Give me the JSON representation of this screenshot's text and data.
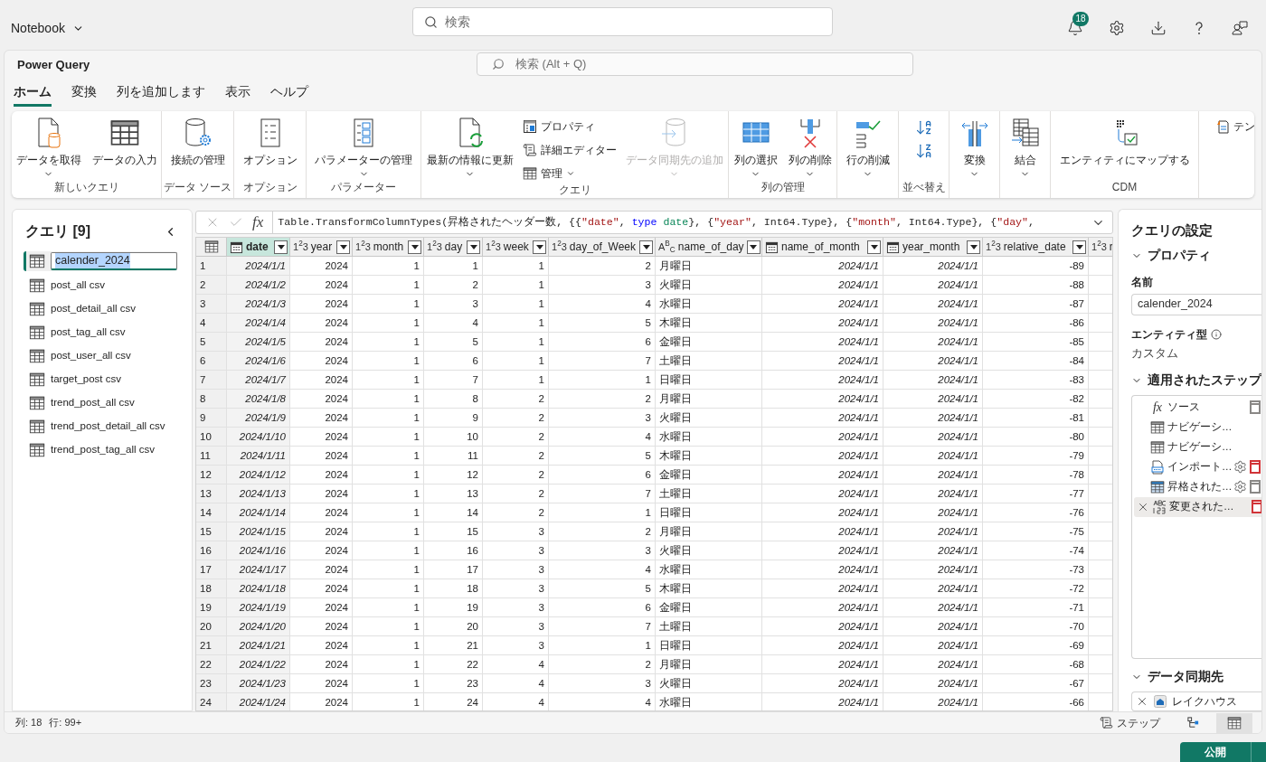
{
  "app_bar": {
    "title": "Notebook",
    "search": {
      "placeholder": "検索"
    },
    "notifications": {
      "count": "18"
    }
  },
  "window": {
    "title": "Power Query",
    "search": {
      "placeholder": "検索 (Alt + Q)"
    }
  },
  "tabs": [
    {
      "label": "ホーム",
      "selected": true
    },
    {
      "label": "変換",
      "selected": false
    },
    {
      "label": "列を追加します",
      "selected": false
    },
    {
      "label": "表示",
      "selected": false
    },
    {
      "label": "ヘルプ",
      "selected": false
    }
  ],
  "ribbon": [
    {
      "label": "新しいクエリ",
      "items": [
        {
          "kind": "large",
          "label": "データを取得",
          "dropdown": true,
          "disabled": false
        },
        {
          "kind": "large",
          "label": "データの入力",
          "dropdown": false,
          "disabled": false
        }
      ]
    },
    {
      "label": "データ ソース",
      "items": [
        {
          "kind": "large",
          "label": "接続の管理",
          "dropdown": false,
          "disabled": false
        }
      ]
    },
    {
      "label": "オプション",
      "items": [
        {
          "kind": "large",
          "label": "オプション",
          "dropdown": false,
          "disabled": false
        }
      ]
    },
    {
      "label": "パラメーター",
      "items": [
        {
          "kind": "large",
          "label": "パラメーターの管理",
          "dropdown": true,
          "disabled": false
        }
      ]
    },
    {
      "label": "クエリ",
      "items": [
        {
          "kind": "large",
          "label": "最新の情報に更新",
          "dropdown": true,
          "disabled": false
        },
        {
          "kind": "small_stack",
          "buttons": [
            {
              "label": "プロパティ",
              "dropdown": false
            },
            {
              "label": "詳細エディター",
              "dropdown": false
            },
            {
              "label": "管理",
              "dropdown": true
            }
          ]
        },
        {
          "kind": "large",
          "label": "データ同期先の追加",
          "dropdown": true,
          "disabled": true
        }
      ]
    },
    {
      "label": "列の管理",
      "items": [
        {
          "kind": "large",
          "label": "列の選択",
          "dropdown": true,
          "disabled": false
        },
        {
          "kind": "large",
          "label": "列の削除",
          "dropdown": true,
          "disabled": false
        }
      ]
    },
    {
      "items": [
        {
          "kind": "large",
          "label": "行の削減",
          "dropdown": true,
          "disabled": false
        }
      ]
    },
    {
      "label": "並べ替え",
      "items": [
        {
          "kind": "sort_stack"
        }
      ]
    },
    {
      "items": [
        {
          "kind": "large",
          "label": "変換",
          "dropdown": true,
          "disabled": false
        }
      ]
    },
    {
      "items": [
        {
          "kind": "large",
          "label": "結合",
          "dropdown": true,
          "disabled": false
        }
      ]
    },
    {
      "label": "CDM",
      "items": [
        {
          "kind": "large",
          "label": "エンティティにマップする",
          "dropdown": false,
          "disabled": false
        }
      ]
    },
    {
      "items": [
        {
          "kind": "small_stack",
          "buttons": [
            {
              "label": "テン",
              "dropdown": false
            }
          ]
        }
      ]
    }
  ],
  "queries": {
    "title": "クエリ [9]",
    "items": [
      {
        "name": "calender_2024",
        "selected": true
      },
      {
        "name": "post_all csv",
        "selected": false
      },
      {
        "name": "post_detail_all csv",
        "selected": false
      },
      {
        "name": "post_tag_all csv",
        "selected": false
      },
      {
        "name": "post_user_all csv",
        "selected": false
      },
      {
        "name": "target_post csv",
        "selected": false
      },
      {
        "name": "trend_post_all csv",
        "selected": false
      },
      {
        "name": "trend_post_detail_all csv",
        "selected": false
      },
      {
        "name": "trend_post_tag_all csv",
        "selected": false
      }
    ]
  },
  "formula_bar": {
    "fx_glyph": "fx",
    "tokens": [
      {
        "kind": "plain",
        "text": "Table.TransformColumnTypes(昇格されたヘッダー数, {{"
      },
      {
        "kind": "string",
        "text": "\"date\""
      },
      {
        "kind": "plain",
        "text": ", "
      },
      {
        "kind": "keyword",
        "text": "type "
      },
      {
        "kind": "type",
        "text": "date"
      },
      {
        "kind": "plain",
        "text": "}, {"
      },
      {
        "kind": "string",
        "text": "\"year\""
      },
      {
        "kind": "plain",
        "text": ", Int64.Type}, {"
      },
      {
        "kind": "string",
        "text": "\"month\""
      },
      {
        "kind": "plain",
        "text": ", Int64.Type}, {"
      },
      {
        "kind": "string",
        "text": "\"day\""
      },
      {
        "kind": "plain",
        "text": ","
      }
    ]
  },
  "table": {
    "columns": [
      {
        "name": "date",
        "kind": "date",
        "selected": true
      },
      {
        "name": "year",
        "kind": "number",
        "type_glyph": "1$^{2}$3",
        "selected": false
      },
      {
        "name": "month",
        "kind": "number",
        "type_glyph": "1$^{2}$3",
        "selected": false
      },
      {
        "name": "day",
        "kind": "number",
        "type_glyph": "1$^{2}$3",
        "selected": false
      },
      {
        "name": "week",
        "kind": "number",
        "type_glyph": "1$^{2}$3",
        "selected": false
      },
      {
        "name": "day_of_Week",
        "kind": "number",
        "type_glyph": "1$^{2}$3",
        "selected": false
      },
      {
        "name": "name_of_day",
        "kind": "text",
        "type_glyph": "A$^{B}$$_{C}$",
        "selected": false
      },
      {
        "name": "name_of_month",
        "kind": "date",
        "selected": false
      },
      {
        "name": "year_month",
        "kind": "date",
        "selected": false
      },
      {
        "name": "relative_date",
        "kind": "number",
        "type_glyph": "1$^{2}$3",
        "selected": false
      },
      {
        "name": "r",
        "kind": "number",
        "type_glyph": "1$^{2}$3",
        "selected": false
      }
    ],
    "rows": [
      {
        "number": "1",
        "cells": [
          "2024/1/1",
          "2024",
          "1",
          "1",
          "1",
          "2",
          "月曜日",
          "2024/1/1",
          "2024/1/1",
          "-89"
        ]
      },
      {
        "number": "2",
        "cells": [
          "2024/1/2",
          "2024",
          "1",
          "2",
          "1",
          "3",
          "火曜日",
          "2024/1/1",
          "2024/1/1",
          "-88"
        ]
      },
      {
        "number": "3",
        "cells": [
          "2024/1/3",
          "2024",
          "1",
          "3",
          "1",
          "4",
          "水曜日",
          "2024/1/1",
          "2024/1/1",
          "-87"
        ]
      },
      {
        "number": "4",
        "cells": [
          "2024/1/4",
          "2024",
          "1",
          "4",
          "1",
          "5",
          "木曜日",
          "2024/1/1",
          "2024/1/1",
          "-86"
        ]
      },
      {
        "number": "5",
        "cells": [
          "2024/1/5",
          "2024",
          "1",
          "5",
          "1",
          "6",
          "金曜日",
          "2024/1/1",
          "2024/1/1",
          "-85"
        ]
      },
      {
        "number": "6",
        "cells": [
          "2024/1/6",
          "2024",
          "1",
          "6",
          "1",
          "7",
          "土曜日",
          "2024/1/1",
          "2024/1/1",
          "-84"
        ]
      },
      {
        "number": "7",
        "cells": [
          "2024/1/7",
          "2024",
          "1",
          "7",
          "1",
          "1",
          "日曜日",
          "2024/1/1",
          "2024/1/1",
          "-83"
        ]
      },
      {
        "number": "8",
        "cells": [
          "2024/1/8",
          "2024",
          "1",
          "8",
          "2",
          "2",
          "月曜日",
          "2024/1/1",
          "2024/1/1",
          "-82"
        ]
      },
      {
        "number": "9",
        "cells": [
          "2024/1/9",
          "2024",
          "1",
          "9",
          "2",
          "3",
          "火曜日",
          "2024/1/1",
          "2024/1/1",
          "-81"
        ]
      },
      {
        "number": "10",
        "cells": [
          "2024/1/10",
          "2024",
          "1",
          "10",
          "2",
          "4",
          "水曜日",
          "2024/1/1",
          "2024/1/1",
          "-80"
        ]
      },
      {
        "number": "11",
        "cells": [
          "2024/1/11",
          "2024",
          "1",
          "11",
          "2",
          "5",
          "木曜日",
          "2024/1/1",
          "2024/1/1",
          "-79"
        ]
      },
      {
        "number": "12",
        "cells": [
          "2024/1/12",
          "2024",
          "1",
          "12",
          "2",
          "6",
          "金曜日",
          "2024/1/1",
          "2024/1/1",
          "-78"
        ]
      },
      {
        "number": "13",
        "cells": [
          "2024/1/13",
          "2024",
          "1",
          "13",
          "2",
          "7",
          "土曜日",
          "2024/1/1",
          "2024/1/1",
          "-77"
        ]
      },
      {
        "number": "14",
        "cells": [
          "2024/1/14",
          "2024",
          "1",
          "14",
          "2",
          "1",
          "日曜日",
          "2024/1/1",
          "2024/1/1",
          "-76"
        ]
      },
      {
        "number": "15",
        "cells": [
          "2024/1/15",
          "2024",
          "1",
          "15",
          "3",
          "2",
          "月曜日",
          "2024/1/1",
          "2024/1/1",
          "-75"
        ]
      },
      {
        "number": "16",
        "cells": [
          "2024/1/16",
          "2024",
          "1",
          "16",
          "3",
          "3",
          "火曜日",
          "2024/1/1",
          "2024/1/1",
          "-74"
        ]
      },
      {
        "number": "17",
        "cells": [
          "2024/1/17",
          "2024",
          "1",
          "17",
          "3",
          "4",
          "水曜日",
          "2024/1/1",
          "2024/1/1",
          "-73"
        ]
      },
      {
        "number": "18",
        "cells": [
          "2024/1/18",
          "2024",
          "1",
          "18",
          "3",
          "5",
          "木曜日",
          "2024/1/1",
          "2024/1/1",
          "-72"
        ]
      },
      {
        "number": "19",
        "cells": [
          "2024/1/19",
          "2024",
          "1",
          "19",
          "3",
          "6",
          "金曜日",
          "2024/1/1",
          "2024/1/1",
          "-71"
        ]
      },
      {
        "number": "20",
        "cells": [
          "2024/1/20",
          "2024",
          "1",
          "20",
          "3",
          "7",
          "土曜日",
          "2024/1/1",
          "2024/1/1",
          "-70"
        ]
      },
      {
        "number": "21",
        "cells": [
          "2024/1/21",
          "2024",
          "1",
          "21",
          "3",
          "1",
          "日曜日",
          "2024/1/1",
          "2024/1/1",
          "-69"
        ]
      },
      {
        "number": "22",
        "cells": [
          "2024/1/22",
          "2024",
          "1",
          "22",
          "4",
          "2",
          "月曜日",
          "2024/1/1",
          "2024/1/1",
          "-68"
        ]
      },
      {
        "number": "23",
        "cells": [
          "2024/1/23",
          "2024",
          "1",
          "23",
          "4",
          "3",
          "火曜日",
          "2024/1/1",
          "2024/1/1",
          "-67"
        ]
      },
      {
        "number": "24",
        "cells": [
          "2024/1/24",
          "2024",
          "1",
          "24",
          "4",
          "4",
          "水曜日",
          "2024/1/1",
          "2024/1/1",
          "-66"
        ]
      }
    ]
  },
  "settings": {
    "title": "クエリの設定",
    "properties": {
      "heading": "プロパティ",
      "name_label": "名前",
      "name_value": "calender_2024",
      "entity_label": "エンティティ型",
      "entity_value": "カスタム"
    },
    "steps_heading": "適用されたステップ",
    "steps": [
      {
        "kind": "fx",
        "glyph": "fx",
        "label": "ソース",
        "settings": false,
        "color": "#8a8886",
        "selected": false
      },
      {
        "kind": "table",
        "label": "ナビゲーシ…",
        "selected": false
      },
      {
        "kind": "table",
        "label": "ナビゲーシ…",
        "selected": false
      },
      {
        "kind": "csv",
        "label": "インポート…",
        "settings": true,
        "color": "#d13438",
        "selected": false
      },
      {
        "kind": "table_blue",
        "label": "昇格された…",
        "settings": true,
        "color": "#8a8886",
        "selected": false
      },
      {
        "kind": "types",
        "label": "変更された…",
        "settings": false,
        "color": "#d13438",
        "selected": true
      }
    ],
    "destination_heading": "データ同期先",
    "destination": {
      "label": "レイクハウス"
    }
  },
  "status_bar": {
    "columns": "列: 18",
    "rows": "行: 99+",
    "steps_button": "ステップ",
    "views": [
      {
        "kind": "diagram",
        "selected": false
      },
      {
        "kind": "table",
        "selected": true
      }
    ]
  },
  "publish_button": "公開"
}
